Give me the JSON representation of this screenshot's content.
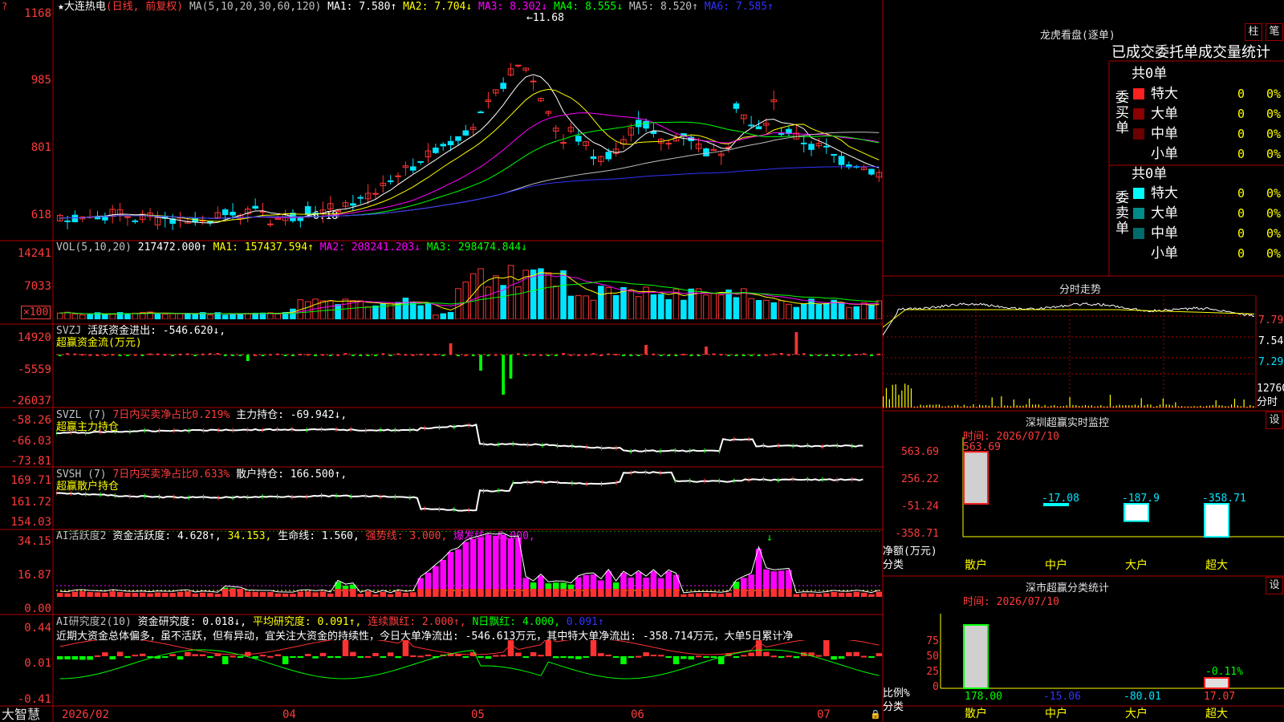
{
  "colors": {
    "up": "#ff3232",
    "down": "#00e5ff",
    "grid": "#b00000",
    "ma1": "#ffffff",
    "ma2": "#ffff00",
    "ma3": "#ff00ff",
    "ma4": "#00ff00",
    "ma5": "#c0c0c0",
    "ma6": "#3232ff",
    "yellow": "#ffff00",
    "green": "#00ff00",
    "magenta": "#ff00ff"
  },
  "main": {
    "header": {
      "name": "★大连热电",
      "mode": "(日线, 前复权)",
      "ma_params": "MA(5,10,20,30,60,120)",
      "ma1": "MA1: 7.580↑",
      "ma2": "MA2: 7.704↓",
      "ma3": "MA3: 8.302↓",
      "ma4": "MA4: 8.555↓",
      "ma5": "MA5: 8.520↑",
      "ma6": "MA6: 7.585↑"
    },
    "axis": [
      "1168",
      "985",
      "801",
      "618"
    ],
    "high_label": "←11.68",
    "low_label": "←6.18"
  },
  "vol": {
    "header": {
      "name": "VOL(5,10,20)",
      "value": "217472.000↑",
      "ma1": "MA1: 157437.594↑",
      "ma2": "MA2: 208241.203↓",
      "ma3": "MA3: 298474.844↓"
    },
    "axis": [
      "14241",
      "7033"
    ],
    "unit": "×100"
  },
  "svzj": {
    "header": {
      "name": "SVZJ",
      "value": "活跃资金进出: -546.620↓,",
      "sub": "超赢资金流(万元)"
    },
    "axis": [
      "14920",
      "-5559",
      "-26037"
    ]
  },
  "svzl": {
    "header": {
      "name": "SVZL (7)",
      "ratio": "7日内买卖净占比0.219%",
      "value": "主力持仓: -69.942↓,",
      "sub": "超赢主力持仓"
    },
    "axis": [
      "-58.26",
      "-66.03",
      "-73.81"
    ]
  },
  "svsh": {
    "header": {
      "name": "SVSH (7)",
      "ratio": "7日内买卖净占比0.633%",
      "value": "散户持仓: 166.500↑,",
      "sub": "超赢散户持仓"
    },
    "axis": [
      "169.71",
      "161.72",
      "154.03"
    ]
  },
  "aihy": {
    "header": {
      "name": "AI活跃度2",
      "v1": "资金活跃度: 4.628↑,",
      "v2": "34.153,",
      "v3": "生命线: 1.560,",
      "v4": "强势线: 3.000,",
      "v5": "爆发线: 6.000,"
    },
    "axis": [
      "34.15",
      "16.87",
      "0.00"
    ]
  },
  "aiyj": {
    "header": {
      "name": "AI研究度2(10)",
      "v1": "资金研究度: 0.018↓,",
      "v2": "平均研究度: 0.091↑,",
      "v3": "连续飘红: 2.000↑,",
      "v4": "N日飘红: 4.000,",
      "v5": "0.091↑"
    },
    "comment": "近期大资金总体偏多，虽不活跃，但有异动，宜关注大资金的持续性，今日大单净流出: -546.613万元，其中特大单净流出: -358.714万元，大单5日累计净",
    "axis": [
      "0.44",
      "0.01",
      "-0.41"
    ]
  },
  "bottom": {
    "brand": "大智慧",
    "dates": [
      "2026/02",
      "04",
      "05",
      "06",
      "07"
    ]
  },
  "longhu": {
    "title": "龙虎看盘(逐单)",
    "tab1": "柱",
    "tab2": "笔",
    "banner": "已成交委托单成交量统计",
    "buy": {
      "side": "委买单",
      "total": "共0单",
      "rows": [
        {
          "label": "特大",
          "n": "0",
          "p": "0%",
          "c": "#ff2020"
        },
        {
          "label": "大单",
          "n": "0",
          "p": "0%",
          "c": "#8b0000"
        },
        {
          "label": "中单",
          "n": "0",
          "p": "0%",
          "c": "#6b0000"
        },
        {
          "label": "小单",
          "n": "0",
          "p": "0%",
          "c": "#000000"
        }
      ]
    },
    "sell": {
      "side": "委卖单",
      "total": "共0单",
      "rows": [
        {
          "label": "特大",
          "n": "0",
          "p": "0%",
          "c": "#00ffff"
        },
        {
          "label": "大单",
          "n": "0",
          "p": "0%",
          "c": "#008b8b"
        },
        {
          "label": "中单",
          "n": "0",
          "p": "0%",
          "c": "#006b6b"
        },
        {
          "label": "小单",
          "n": "0",
          "p": "0%",
          "c": "#000000"
        }
      ]
    }
  },
  "fenshi": {
    "title": "分时走势",
    "axis": [
      "7.79",
      "7.54",
      "7.29"
    ],
    "vol_label": "12760",
    "vol_unit": "分时"
  },
  "szsm": {
    "title": "深圳超赢实时监控",
    "btn": "设",
    "time": "时间: 2026/07/10",
    "axis": [
      "563.69",
      "256.22",
      "-51.24",
      "-358.71"
    ],
    "ylabel": "净额(万元)",
    "xlabel": "分类",
    "cats": [
      "散户",
      "中户",
      "大户",
      "超大"
    ],
    "values": [
      "563.69",
      "-17.08",
      "-187.9",
      "-358.71"
    ]
  },
  "szfl": {
    "title": "深市超赢分类统计",
    "btn": "设",
    "time": "时间: 2026/07/10",
    "axis": [
      "75",
      "50",
      "25",
      "0"
    ],
    "ylabel": "比例%",
    "xlabel": "分类",
    "cats": [
      "散户",
      "中户",
      "大户",
      "超大"
    ],
    "values": [
      "178.00",
      "-15.06",
      "-80.01",
      "17.07"
    ],
    "annot": "-0.11%"
  }
}
